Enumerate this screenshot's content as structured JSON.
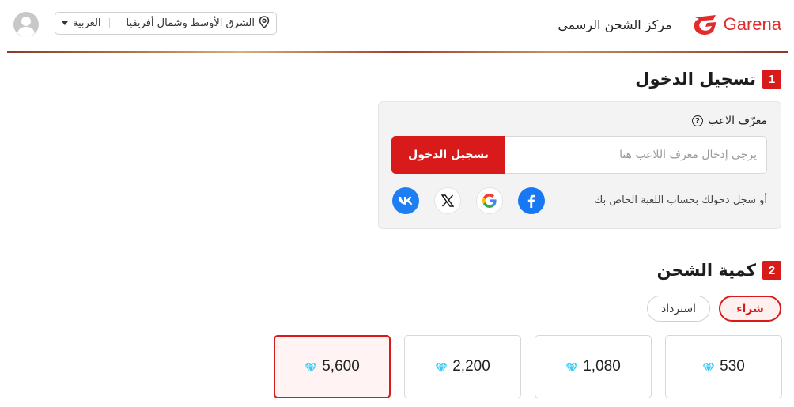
{
  "header": {
    "brand": "Garena",
    "title": "مركز الشحن الرسمي",
    "region": "الشرق الأوسط وشمال أفريقيا",
    "language": "العربية"
  },
  "login_section": {
    "number": "1",
    "title": "تسجيل الدخول",
    "field_label": "معرّف الاعب",
    "input_placeholder": "يرجى إدخال معرف اللاعب هنا",
    "login_button": "تسجيل الدخول",
    "social_prompt": "أو سجل دخولك بحساب اللعبة الخاص بك",
    "social_icons": [
      "facebook-icon",
      "google-icon",
      "x-icon",
      "vk-icon"
    ]
  },
  "amount_section": {
    "number": "2",
    "title": "كمية الشحن",
    "tabs": [
      {
        "label": "شراء",
        "active": true
      },
      {
        "label": "استرداد",
        "active": false
      }
    ],
    "amounts": [
      {
        "value": "530",
        "selected": false
      },
      {
        "value": "1,080",
        "selected": false
      },
      {
        "value": "2,200",
        "selected": false
      },
      {
        "value": "5,600",
        "selected": true
      }
    ]
  },
  "colors": {
    "accent": "#d81a1a",
    "card_bg": "#f3f3f3",
    "diamond": "#3cc8f0"
  }
}
